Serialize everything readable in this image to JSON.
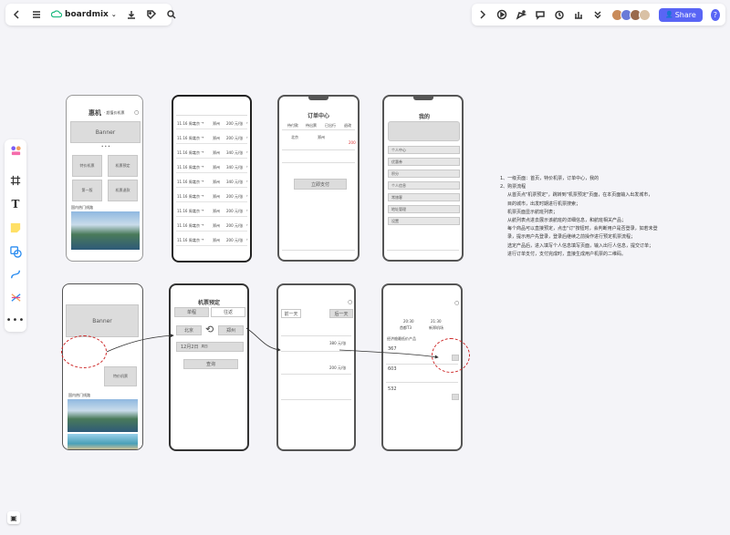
{
  "app": {
    "name": "boardmix",
    "share_label": "Share",
    "help": "?"
  },
  "phones": {
    "p1": {
      "title": "惠机",
      "subtitle": "· 超值价机票",
      "banner": "Banner",
      "btn1": "特价机票",
      "btn2": "机票预定",
      "btn3": "第一版",
      "btn4": "机票退款",
      "section": "国内热门线路"
    },
    "p2": {
      "rows": [
        {
          "date": "11.16 周二",
          "from": "北京",
          "to": "郑州",
          "price": "200 元/张"
        },
        {
          "date": "11.16 周二",
          "from": "北京",
          "to": "郑州",
          "price": "200 元/张"
        },
        {
          "date": "11.16 周二",
          "from": "北京",
          "to": "郑州",
          "price": "340 元/张"
        },
        {
          "date": "11.16 周二",
          "from": "北京",
          "to": "郑州",
          "price": "340 元/张"
        },
        {
          "date": "11.16 周二",
          "from": "北京",
          "to": "郑州",
          "price": "340 元/张"
        },
        {
          "date": "11.16 周二",
          "from": "北京",
          "to": "郑州",
          "price": "200 元/张"
        },
        {
          "date": "11.16 周二",
          "from": "北京",
          "to": "郑州",
          "price": "200 元/张"
        },
        {
          "date": "11.16 周二",
          "from": "北京",
          "to": "郑州",
          "price": "200 元/张"
        },
        {
          "date": "11.16 周二",
          "from": "北京",
          "to": "郑州",
          "price": "200 元/张"
        }
      ]
    },
    "p3": {
      "title": "订单中心",
      "tabs": [
        "待付款",
        "待出票",
        "已出行",
        "退改"
      ],
      "route_from": "北京",
      "route_to": "郑州",
      "price": "200",
      "pay_button": "立即支付"
    },
    "p4": {
      "title": "我的",
      "menu": [
        "个人中心",
        "优惠券",
        "积分",
        "个人信息",
        "常旅客",
        "地址管理",
        "设置"
      ]
    },
    "p5": {
      "banner": "Banner",
      "btn": "特价机票",
      "section": "国内热门线路"
    },
    "p6": {
      "title": "机票预定",
      "tab_one": "单程",
      "tab_round": "往返",
      "from": "北京",
      "to": "郑州",
      "date": "12月2日",
      "weekday": "周四",
      "search": "查询"
    },
    "p7": {
      "prev_day": "前一天",
      "next_day": "后一天",
      "price1": "380 元/张",
      "price2": "200 元/张"
    },
    "p8": {
      "depart_time": "20:30",
      "arrive_time": "21:30",
      "depart_place": "首都T3",
      "arrive_place": "新郑机场",
      "section": "经济舱最低价产品",
      "prices": [
        "367",
        "603",
        "532"
      ]
    }
  },
  "notes": {
    "lines": [
      "1、一级页面：首页，特价机票，订单中心，我的",
      "2、购票流程"
    ],
    "bullets": [
      "从首页点\"机票预定\"，跳转到\"机票预定\"页面，在本页面输入出发城市，",
      "目的城市，出发时期进行机票搜索；",
      "机票页面显示航班列表；",
      "从航列表点进去展示该航班的详细信息，和航班相关产品；",
      "每个商品可以直接预定，点击\"订\"按钮时，会判断用户是否登录，如若未登",
      "录，提示用户先登录，登录后继续之前操作进行预定机票流程；",
      "选定产品后，进入填写个人信息填写页面，输入出行人信息，提交订单；",
      "进行订单支付，支付完成时，直接生成用户机票的二维码。"
    ]
  },
  "colors": {
    "accent": "#5965f5",
    "annotation": "#cc2222"
  }
}
